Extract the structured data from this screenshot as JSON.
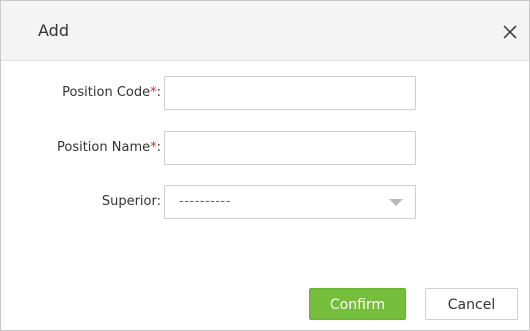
{
  "dialog": {
    "title": "Add",
    "close_icon": "close-icon"
  },
  "form": {
    "position_code": {
      "label": "Position Code",
      "required_mark": "*",
      "colon": ":",
      "value": ""
    },
    "position_name": {
      "label": "Position Name",
      "required_mark": "*",
      "colon": ":",
      "value": ""
    },
    "superior": {
      "label": "Superior:",
      "selected": "----------"
    }
  },
  "buttons": {
    "confirm": "Confirm",
    "cancel": "Cancel"
  },
  "colors": {
    "confirm_bg": "#74be3b",
    "required": "#e02b2b",
    "header_bg": "#f4f4f4"
  }
}
